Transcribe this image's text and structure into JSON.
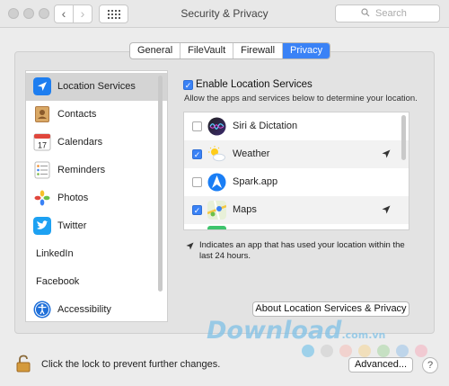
{
  "window": {
    "title": "Security & Privacy"
  },
  "toolbar": {
    "back_icon": "chevron-left-icon",
    "forward_icon": "chevron-right-icon",
    "grid_icon": "grid-icon"
  },
  "search": {
    "placeholder": "Search"
  },
  "tabs": [
    {
      "label": "General",
      "active": false
    },
    {
      "label": "FileVault",
      "active": false
    },
    {
      "label": "Firewall",
      "active": false
    },
    {
      "label": "Privacy",
      "active": true
    }
  ],
  "sidebar": {
    "items": [
      {
        "label": "Location Services",
        "icon": "location-arrow-icon",
        "selected": true
      },
      {
        "label": "Contacts",
        "icon": "contacts-icon"
      },
      {
        "label": "Calendars",
        "icon": "calendar-icon"
      },
      {
        "label": "Reminders",
        "icon": "reminders-icon"
      },
      {
        "label": "Photos",
        "icon": "photos-icon"
      },
      {
        "label": "Twitter",
        "icon": "twitter-icon"
      },
      {
        "label": "LinkedIn",
        "icon": ""
      },
      {
        "label": "Facebook",
        "icon": ""
      },
      {
        "label": "Accessibility",
        "icon": "accessibility-icon"
      }
    ],
    "calendar_day": "17"
  },
  "location": {
    "enable_label": "Enable Location Services",
    "enable_checked": true,
    "description": "Allow the apps and services below to determine your location.",
    "apps": [
      {
        "name": "Siri & Dictation",
        "checked": false,
        "used_recently": false,
        "icon": "siri-icon"
      },
      {
        "name": "Weather",
        "checked": true,
        "used_recently": true,
        "icon": "weather-icon"
      },
      {
        "name": "Spark.app",
        "checked": false,
        "used_recently": false,
        "icon": "spark-icon"
      },
      {
        "name": "Maps",
        "checked": true,
        "used_recently": true,
        "icon": "maps-icon"
      }
    ],
    "legend": "Indicates an app that has used your location within the last 24 hours.",
    "about_button": "About Location Services & Privacy"
  },
  "footer": {
    "lock_text": "Click the lock to prevent further changes.",
    "advanced_button": "Advanced...",
    "help_label": "?"
  },
  "watermark": {
    "text": "Download",
    "sub": ".com.vn"
  },
  "colors": {
    "accent": "#3a82f6"
  }
}
